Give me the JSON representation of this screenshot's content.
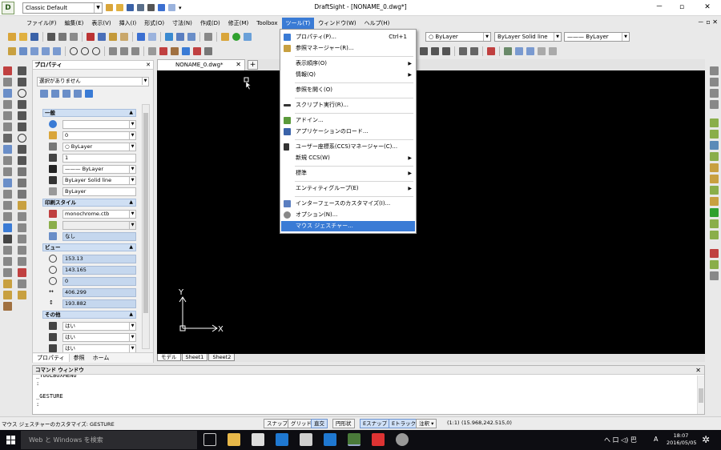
{
  "titlebar": {
    "workspace": "Classic Default",
    "window_title": "DraftSight - [NONAME_0.dwg*]",
    "minimize": "－",
    "restore": "▫",
    "close": "✕"
  },
  "menubar": {
    "items": [
      "ファイル(F)",
      "編集(E)",
      "表示(V)",
      "挿入(I)",
      "形式(O)",
      "寸法(N)",
      "作成(D)",
      "修正(M)",
      "Toolbox",
      "ツール(T)",
      "ウィンドウ(W)",
      "ヘルプ(H)"
    ],
    "active": "ツール(T)",
    "mdi_controls": "－ ▫ ✕"
  },
  "toolbar": {
    "color_combo": "ByLayer",
    "linestyle_combo": "ByLayer    Solid line",
    "lineweight_combo": "——— ByLayer"
  },
  "properties": {
    "title": "プロパティ",
    "close": "✕",
    "selection": "選択がありません",
    "sections": {
      "general": "一般",
      "print_style": "印刷スタイル",
      "view": "ビュー",
      "other": "その他"
    },
    "general_fields": [
      "",
      "0",
      "○ ByLayer",
      "1",
      "——— ByLayer",
      "ByLayer    Solid line",
      "ByLayer"
    ],
    "print_fields": [
      "monochrome.ctb",
      "",
      "なし"
    ],
    "view_fields": [
      "153.13",
      "143.165",
      "0",
      "406.299",
      "193.882"
    ],
    "other_fields": [
      "はい",
      "はい",
      "はい"
    ],
    "tabs": [
      "プロパティ",
      "参照",
      "ホーム"
    ]
  },
  "document": {
    "tab_label": "NONAME_0.dwg*",
    "tab_close": "✕",
    "add_tab": "+",
    "layout_tabs": [
      "モデル",
      "Sheet1",
      "Sheet2"
    ],
    "ucs_x": "X",
    "ucs_y": "Y"
  },
  "tools_menu": {
    "items": [
      {
        "label": "プロパティ(P)...",
        "shortcut": "Ctrl+1",
        "arrow": ""
      },
      {
        "label": "参照マネージャー(R)...",
        "shortcut": "",
        "arrow": ""
      },
      {
        "label": "表示順序(O)",
        "shortcut": "",
        "arrow": "▶"
      },
      {
        "label": "情報(Q)",
        "shortcut": "",
        "arrow": "▶"
      },
      {
        "label": "参照を開く(O)",
        "shortcut": "",
        "arrow": ""
      },
      {
        "label": "スクリプト実行(R)...",
        "shortcut": "",
        "arrow": ""
      },
      {
        "label": "アドイン...",
        "shortcut": "",
        "arrow": ""
      },
      {
        "label": "アプリケーションのロード...",
        "shortcut": "",
        "arrow": ""
      },
      {
        "label": "ユーザー座標系(CCS)マネージャー(C)...",
        "shortcut": "",
        "arrow": ""
      },
      {
        "label": "新規 CCS(W)",
        "shortcut": "",
        "arrow": "▶"
      },
      {
        "label": "標準",
        "shortcut": "",
        "arrow": "▶"
      },
      {
        "label": "エンティティグループ(E)",
        "shortcut": "",
        "arrow": "▶"
      },
      {
        "label": "インターフェースのカスタマイズ(I)...",
        "shortcut": "",
        "arrow": ""
      },
      {
        "label": "オプション(N)...",
        "shortcut": "",
        "arrow": ""
      },
      {
        "label": "マウス ジェスチャー...",
        "shortcut": "",
        "arrow": ""
      }
    ]
  },
  "command_window": {
    "title": "コマンド ウィンドウ",
    "close": "✕",
    "lines": [
      "_TOOLBOXMENU",
      ":",
      "_GESTURE",
      ":"
    ]
  },
  "statusbar": {
    "message": "マウス ジェスチャーのカスタマイズ:  GESTURE",
    "buttons": [
      "スナップ",
      "グリッド",
      "直交",
      "円形状",
      "Eスナップ",
      "Eトラック",
      "注釈"
    ],
    "scale": "(1:1)",
    "coordinates": "(15.968,242.515,0)"
  },
  "taskbar": {
    "search_placeholder": "Web と Windows を検索",
    "time": "18:07",
    "date": "2016/05/05",
    "ime": "A",
    "tray": "へ 口 ◁) 巴"
  },
  "colors": {
    "accent": "#3a7bd5",
    "canvas": "#000000",
    "section_header": "#cfdff3",
    "field_highlight": "#c5d7ee"
  }
}
